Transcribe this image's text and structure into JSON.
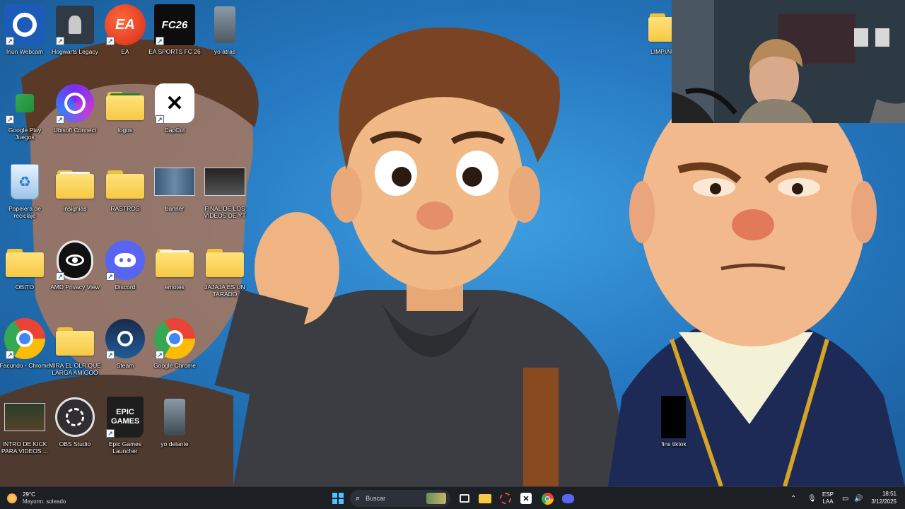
{
  "desktop": {
    "icons": [
      {
        "label": "Iriun Webcam",
        "icon": "iriun-webcam-icon"
      },
      {
        "label": "Hogwarts Legacy",
        "icon": "hogwarts-legacy-icon"
      },
      {
        "label": "EA",
        "icon": "ea-icon",
        "icon_text": "EA"
      },
      {
        "label": "EA SPORTS FC 26",
        "icon": "ea-sports-fc26-icon",
        "icon_text": "FC26"
      },
      {
        "label": "yo atras",
        "icon": "image-file-icon"
      },
      {
        "label": "Google Play Juegos",
        "icon": "google-play-games-icon"
      },
      {
        "label": "Ubisoft Connect",
        "icon": "ubisoft-connect-icon"
      },
      {
        "label": "logos",
        "icon": "folder-icon"
      },
      {
        "label": "CapCut",
        "icon": "capcut-icon"
      },
      {
        "label": "Papelera de reciclaje",
        "icon": "recycle-bin-icon"
      },
      {
        "label": "insignias",
        "icon": "folder-icon"
      },
      {
        "label": "RASTROS",
        "icon": "folder-icon"
      },
      {
        "label": "banner",
        "icon": "image-thumbnail-icon"
      },
      {
        "label": "FINAL DE LOS VIDEOS DE YT",
        "icon": "image-thumbnail-icon"
      },
      {
        "label": "OBITO",
        "icon": "folder-icon"
      },
      {
        "label": "AMD Privacy View",
        "icon": "amd-privacy-view-icon"
      },
      {
        "label": "Discord",
        "icon": "discord-icon"
      },
      {
        "label": "emotes",
        "icon": "folder-icon"
      },
      {
        "label": "JAJAJA ES UN TARADO",
        "icon": "folder-icon"
      },
      {
        "label": "Facundo - Chrome",
        "icon": "chrome-profile-icon"
      },
      {
        "label": "MIRA EL OLR QUE LARGA AMIGOO",
        "icon": "folder-icon"
      },
      {
        "label": "Steam",
        "icon": "steam-icon"
      },
      {
        "label": "Google Chrome",
        "icon": "chrome-icon"
      },
      {
        "label": "INTRO DE KICK PARA VIDEOS ...",
        "icon": "video-thumbnail-icon"
      },
      {
        "label": "OBS Studio",
        "icon": "obs-studio-icon"
      },
      {
        "label": "Epic Games Launcher",
        "icon": "epic-games-icon",
        "icon_text": "EPIC GAMES"
      },
      {
        "label": "yo delante",
        "icon": "image-file-icon"
      },
      {
        "label": "LIMPIAR",
        "icon": "folder-icon"
      },
      {
        "label": "fins tiktok",
        "icon": "black-file-icon"
      }
    ]
  },
  "taskbar": {
    "weather": {
      "temp": "29°C",
      "desc": "Mayorm. soleado"
    },
    "search_placeholder": "Buscar",
    "apps": [
      "start-icon",
      "widgets-icon",
      "task-view-icon",
      "file-explorer-icon",
      "snipping-tool-icon",
      "capcut-icon",
      "chrome-icon",
      "discord-icon"
    ],
    "tray": {
      "lang1": "ESP",
      "lang2": "LAA"
    },
    "clock": {
      "time": "18:51",
      "date": "3/12/2025"
    }
  },
  "colors": {
    "taskbar_bg": "#1c1f24",
    "wallpaper_blue": "#2679c2",
    "folder_yellow": "#f6c945"
  }
}
